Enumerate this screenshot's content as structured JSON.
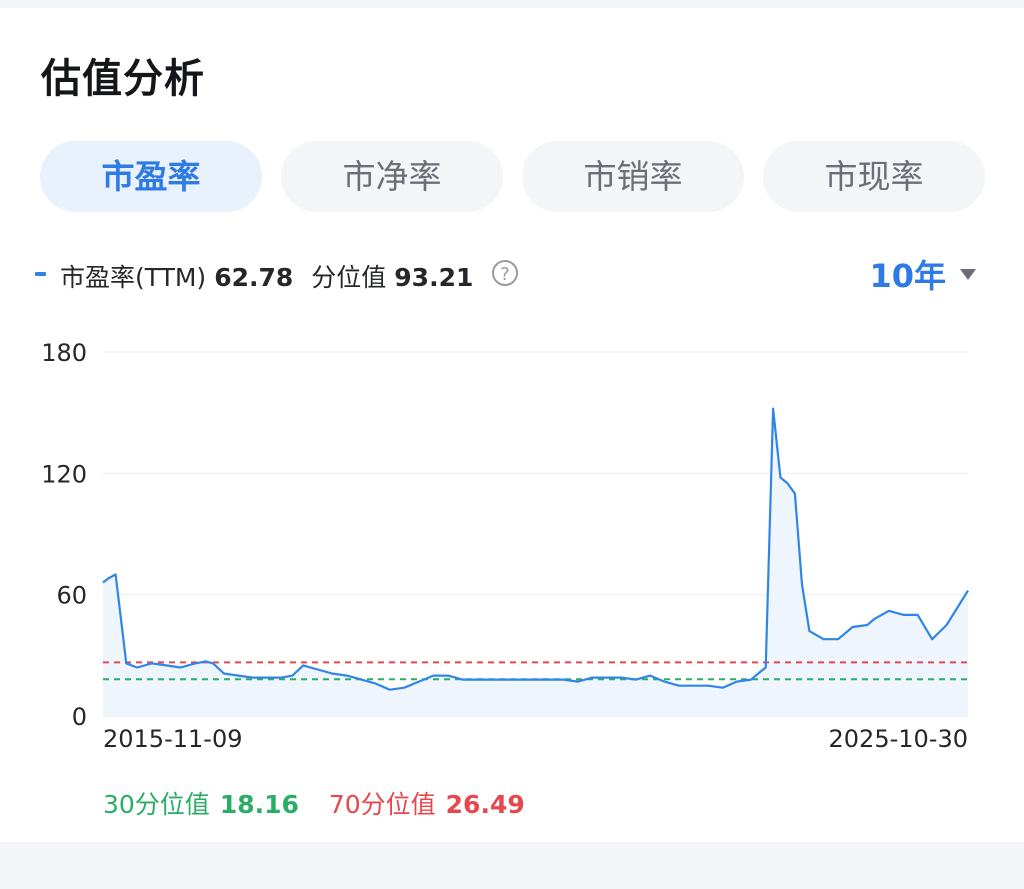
{
  "header": {
    "title": "估值分析"
  },
  "tabs": [
    {
      "label": "市盈率",
      "active": true
    },
    {
      "label": "市净率",
      "active": false
    },
    {
      "label": "市销率",
      "active": false
    },
    {
      "label": "市现率",
      "active": false
    }
  ],
  "legend": {
    "series_label": "市盈率(TTM)",
    "series_value": "62.78",
    "percentile_label": "分位值",
    "percentile_value": "93.21",
    "help_icon": "question-circle-icon"
  },
  "range": {
    "label": "10年",
    "icon": "caret-down-icon"
  },
  "percentiles": {
    "p30_label": "30分位值",
    "p30_value": "18.16",
    "p70_label": "70分位值",
    "p70_value": "26.49"
  },
  "colors": {
    "series": "#2f86e6",
    "area": "#eef5fd",
    "p30": "#2aae64",
    "p70": "#e5484d",
    "accent": "#2f7be6"
  },
  "chart_data": {
    "type": "line",
    "x_start_label": "2015-11-09",
    "x_end_label": "2025-10-30",
    "ylim": [
      0,
      180
    ],
    "yticks": [
      0,
      60,
      120,
      180
    ],
    "grid": true,
    "reference_lines": [
      {
        "value": 26.49,
        "color": "#e5484d"
      },
      {
        "value": 18.16,
        "color": "#2aae64"
      }
    ],
    "series": [
      {
        "x": [
          "2015-11-09",
          "2015-12-01",
          "2016-01-01",
          "2016-02-15",
          "2016-04-01",
          "2016-06-01",
          "2016-08-01",
          "2016-10-01",
          "2016-12-01",
          "2017-01-15",
          "2017-02-15",
          "2017-04-01",
          "2017-06-01",
          "2017-08-01",
          "2017-10-01",
          "2017-12-01",
          "2018-01-15",
          "2018-03-01",
          "2018-05-01",
          "2018-07-01",
          "2018-09-01",
          "2018-11-01",
          "2019-01-01",
          "2019-03-01",
          "2019-05-01",
          "2019-07-01",
          "2019-09-01",
          "2019-11-01",
          "2020-01-01",
          "2020-03-01",
          "2020-05-01",
          "2020-07-01",
          "2020-09-01",
          "2020-11-01",
          "2021-01-01",
          "2021-03-01",
          "2021-05-01",
          "2021-07-01",
          "2021-09-01",
          "2021-11-01",
          "2022-01-01",
          "2022-03-01",
          "2022-05-01",
          "2022-07-01",
          "2022-09-01",
          "2022-11-01",
          "2023-01-01",
          "2023-03-01",
          "2023-05-01",
          "2023-05-20",
          "2023-06-10",
          "2023-07-01",
          "2023-08-01",
          "2023-09-01",
          "2023-10-01",
          "2023-11-01",
          "2023-12-01",
          "2024-01-01",
          "2024-03-01",
          "2024-05-01",
          "2024-07-01",
          "2024-09-01",
          "2024-10-01",
          "2024-12-01",
          "2025-02-01",
          "2025-04-01",
          "2025-06-01",
          "2025-08-01",
          "2025-10-30"
        ],
        "y": [
          66,
          68,
          70,
          26,
          24,
          26,
          25,
          24,
          26,
          27,
          26,
          21,
          20,
          19,
          19,
          19,
          20,
          25,
          23,
          21,
          20,
          18,
          16,
          13,
          14,
          17,
          20,
          20,
          18,
          18,
          18,
          18,
          18,
          18,
          18,
          18,
          17,
          19,
          19,
          19,
          18,
          20,
          17,
          15,
          15,
          15,
          14,
          17,
          18,
          20,
          22,
          24,
          152,
          118,
          115,
          110,
          65,
          42,
          38,
          38,
          44,
          45,
          48,
          52,
          50,
          50,
          38,
          45,
          62
        ]
      }
    ]
  }
}
